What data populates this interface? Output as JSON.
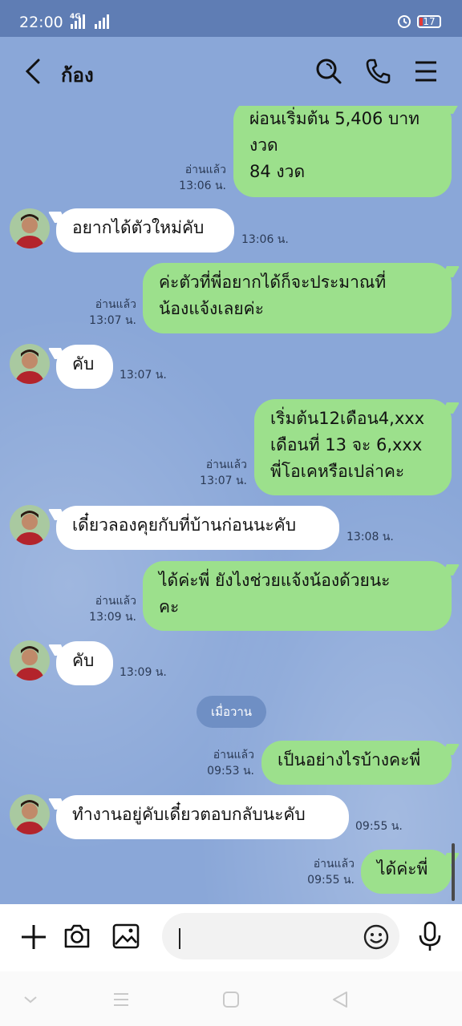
{
  "status_bar": {
    "time": "22:00",
    "network": "4G",
    "battery": "17",
    "battery_color": "#e53935"
  },
  "header": {
    "contact_name": "ก้อง"
  },
  "messages": [
    {
      "side": "out",
      "lines": [
        "ผ่อนเริ่มต้น 5,406 บาท",
        "งวด",
        "84 งวด"
      ],
      "read": "อ่านแล้ว",
      "time": "13:06 น."
    },
    {
      "side": "in",
      "lines": [
        "อยากได้ตัวใหม่คับ"
      ],
      "time": "13:06 น."
    },
    {
      "side": "out",
      "lines": [
        "ค่ะตัวที่พี่อยากได้ก็จะประมาณที่",
        "น้องแจ้งเลยค่ะ"
      ],
      "read": "อ่านแล้ว",
      "time": "13:07 น."
    },
    {
      "side": "in",
      "lines": [
        "คับ"
      ],
      "time": "13:07 น."
    },
    {
      "side": "out",
      "lines": [
        "เริ่มต้น12เดือน4,xxx",
        "เดือนที่ 13 จะ 6,xxx",
        "พี่โอเคหรือเปล่าคะ"
      ],
      "read": "อ่านแล้ว",
      "time": "13:07 น."
    },
    {
      "side": "in",
      "lines": [
        "เดี๋ยวลองคุยกับที่บ้านก่อนนะคับ"
      ],
      "time": "13:08 น."
    },
    {
      "side": "out",
      "lines": [
        "ได้ค่ะพี่ ยังไงช่วยแจ้งน้องด้วยนะ",
        "คะ"
      ],
      "read": "อ่านแล้ว",
      "time": "13:09 น."
    },
    {
      "side": "in",
      "lines": [
        "คับ"
      ],
      "time": "13:09 น."
    },
    {
      "side": "out",
      "lines": [
        "เป็นอย่างไรบ้างคะพี่"
      ],
      "read": "อ่านแล้ว",
      "time": "09:53 น."
    },
    {
      "side": "in",
      "lines": [
        "ทำงานอยู่คับเดี๋ยวตอบกลับนะคับ"
      ],
      "time": "09:55 น."
    },
    {
      "side": "out",
      "lines": [
        "ได้ค่ะพี่"
      ],
      "read": "อ่านแล้ว",
      "time": "09:55 น."
    }
  ],
  "date_separator": "เมื่อวาน",
  "input": {
    "value": "",
    "placeholder": ""
  },
  "colors": {
    "chat_bg": "#8aa7d8",
    "outgoing_bubble": "#9ce08c",
    "incoming_bubble": "#ffffff"
  },
  "icons": [
    "back-icon",
    "search-icon",
    "phone-icon",
    "menu-icon",
    "plus-icon",
    "camera-icon",
    "image-icon",
    "emoji-icon",
    "mic-icon"
  ]
}
